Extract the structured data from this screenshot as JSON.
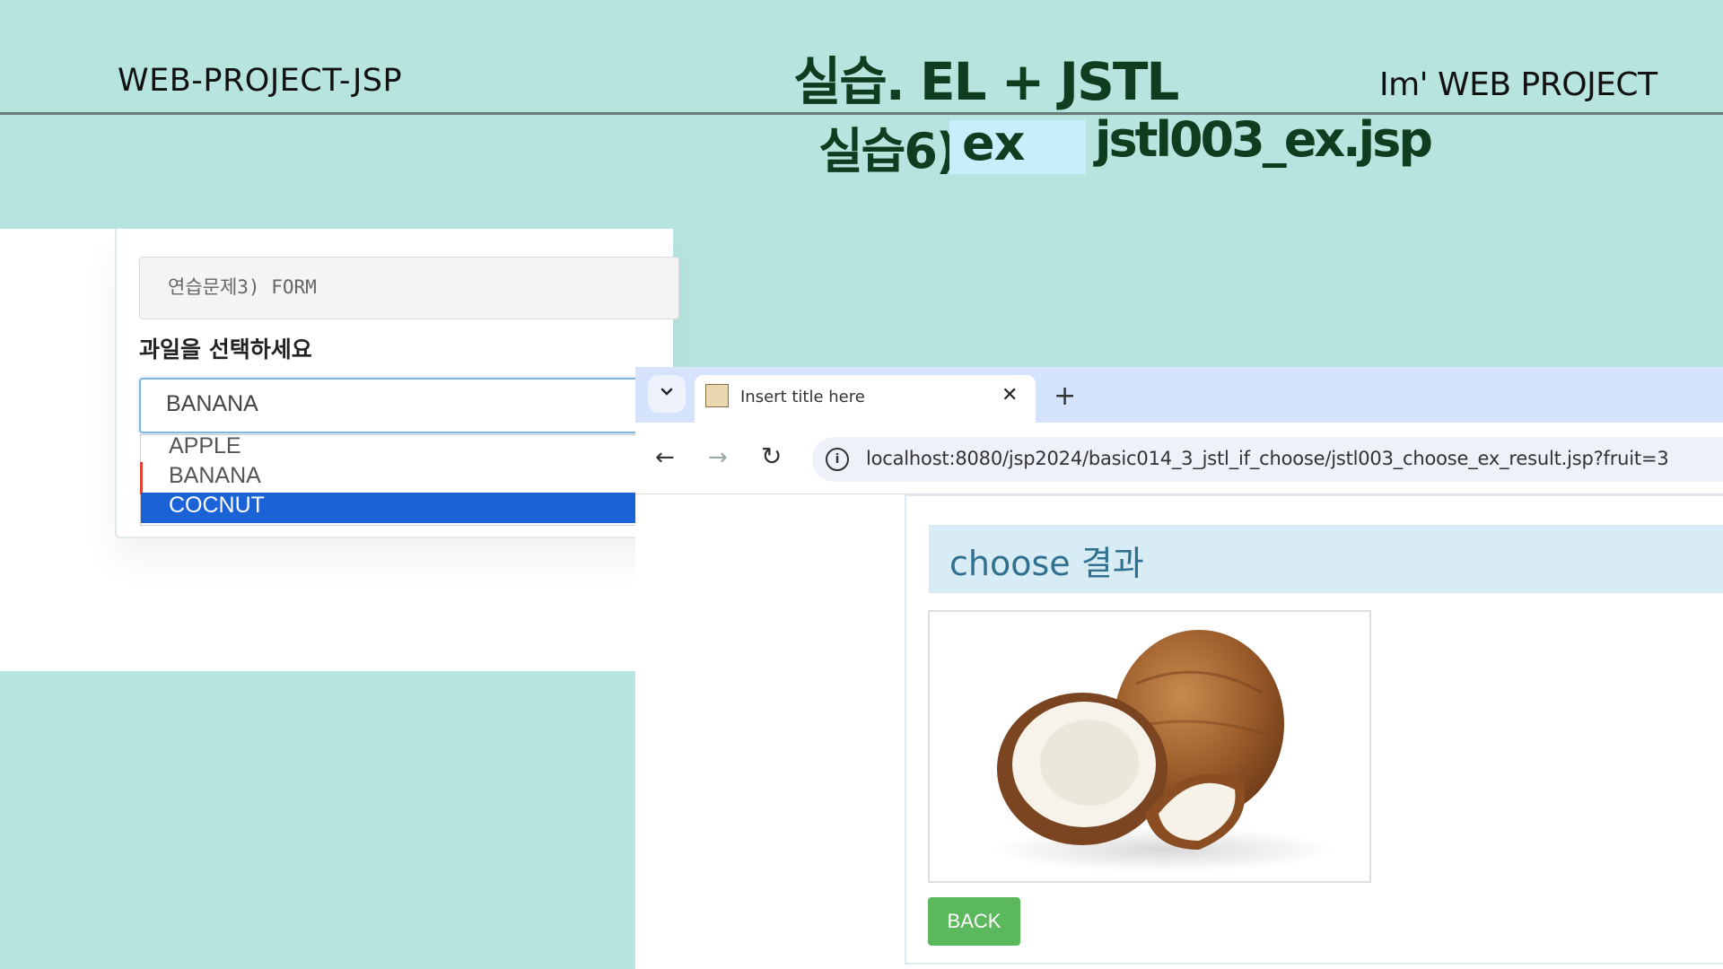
{
  "slide": {
    "header_left": "WEB-PROJECT-JSP",
    "title": "실습. EL + JSTL",
    "header_right": "Im' WEB PROJECT",
    "subtitle_prefix": "실습6)",
    "subtitle_highlight": "ex",
    "subtitle_file": "jstl003_ex.jsp"
  },
  "form_page": {
    "form_label": "연습문제3) FORM",
    "select_label": "과일을 선택하세요",
    "select_value": "BANANA",
    "options": [
      "APPLE",
      "BANANA",
      "COCNUT"
    ],
    "selected_option": "COCNUT"
  },
  "browser": {
    "tab_title": "Insert title here",
    "url": "localhost:8080/jsp2024/basic014_3_jstl_if_choose/jstl003_choose_ex_result.jsp?fruit=3"
  },
  "result_page": {
    "heading": "choose 결과",
    "image_alt": "coconut",
    "back_label": "BACK"
  },
  "colors": {
    "slide_bg": "#b8e4df",
    "title_color": "#0f3d1f",
    "highlight_bg": "#c7eefb",
    "dropdown_selected": "#1a62d6",
    "back_button": "#5cb85c",
    "result_heading_bg": "#d8ecf5"
  }
}
